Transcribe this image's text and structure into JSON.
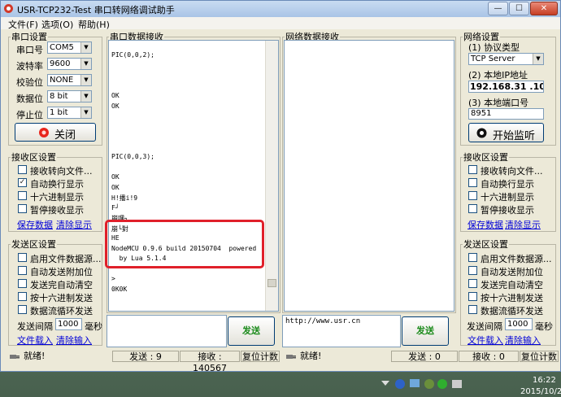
{
  "window": {
    "title": "USR-TCP232-Test 串口转网络调试助手"
  },
  "menu": [
    "文件(F)",
    "选项(O)",
    "帮助(H)"
  ],
  "serial": {
    "legend": "串口设置",
    "port": {
      "label": "串口号",
      "value": "COM5"
    },
    "baud": {
      "label": "波特率",
      "value": "9600"
    },
    "parity": {
      "label": "校验位",
      "value": "NONE"
    },
    "databits": {
      "label": "数据位",
      "value": "8 bit"
    },
    "stopbits": {
      "label": "停止位",
      "value": "1 bit"
    },
    "button": "关闭"
  },
  "recv_left": {
    "legend": "接收区设置",
    "options": [
      {
        "label": "接收转向文件...",
        "checked": false
      },
      {
        "label": "自动换行显示",
        "checked": true
      },
      {
        "label": "十六进制显示",
        "checked": false
      },
      {
        "label": "暂停接收显示",
        "checked": false
      }
    ],
    "save": "保存数据",
    "clear": "清除显示"
  },
  "send_left": {
    "legend": "发送区设置",
    "options": [
      {
        "label": "启用文件数据源...",
        "checked": false
      },
      {
        "label": "自动发送附加位",
        "checked": false
      },
      {
        "label": "发送完自动清空",
        "checked": false
      },
      {
        "label": "按十六进制发送",
        "checked": false
      },
      {
        "label": "数据流循环发送",
        "checked": false
      }
    ],
    "interval_label": "发送间隔",
    "interval_value": "1000",
    "interval_unit": "毫秒",
    "file_load": "文件载入",
    "clear_input": "清除输入"
  },
  "serial_recv": {
    "legend": "串口数据接收",
    "lines": [
      "PIC(0,0,2);",
      "",
      "",
      "",
      "OK",
      "OK",
      "",
      "",
      "",
      "",
      "PIC(0,0,3);",
      "",
      "OK",
      "OK",
      "H!播i!9",
      "F┘",
      "崩嘿┐",
      "崩└對",
      "HE",
      "NodeMCU 0.9.6 build 20150704  powered",
      "  by Lua 5.1.4",
      "",
      ">",
      "0K0K"
    ]
  },
  "net_recv": {
    "legend": "网络数据接收"
  },
  "serial_send": {
    "value": "",
    "button": "发送"
  },
  "net_send": {
    "value": "http://www.usr.cn",
    "button": "发送"
  },
  "net": {
    "legend": "网络设置",
    "protocol_label": "(1) 协议类型",
    "protocol": "TCP Server",
    "ip_label": "(2) 本地IP地址",
    "ip": "192.168.31 .106",
    "port_label": "(3) 本地端口号",
    "port": "8951",
    "button": "开始监听"
  },
  "recv_right": {
    "legend": "接收区设置",
    "options": [
      {
        "label": "接收转向文件...",
        "checked": false
      },
      {
        "label": "自动换行显示",
        "checked": false
      },
      {
        "label": "十六进制显示",
        "checked": false
      },
      {
        "label": "暂停接收显示",
        "checked": false
      }
    ],
    "save": "保存数据",
    "clear": "清除显示"
  },
  "send_right": {
    "legend": "发送区设置",
    "options": [
      {
        "label": "启用文件数据源...",
        "checked": false
      },
      {
        "label": "自动发送附加位",
        "checked": false
      },
      {
        "label": "发送完自动清空",
        "checked": false
      },
      {
        "label": "按十六进制发送",
        "checked": false
      },
      {
        "label": "数据流循环发送",
        "checked": false
      }
    ],
    "interval_label": "发送间隔",
    "interval_value": "1000",
    "interval_unit": "毫秒",
    "file_load": "文件载入",
    "clear_input": "清除输入"
  },
  "status": {
    "left": {
      "ready": "就绪!",
      "sent": "发送 : 9",
      "recv": "接收 : 140567",
      "reset": "复位计数"
    },
    "right": {
      "ready": "就绪!",
      "sent": "发送 : 0",
      "recv": "接收 : 0",
      "reset": "复位计数"
    }
  },
  "clock": {
    "time": "16:22",
    "date": "2015/10/2"
  },
  "colors": {
    "highlight": "#e0202a",
    "title": "#b5cdeb"
  }
}
